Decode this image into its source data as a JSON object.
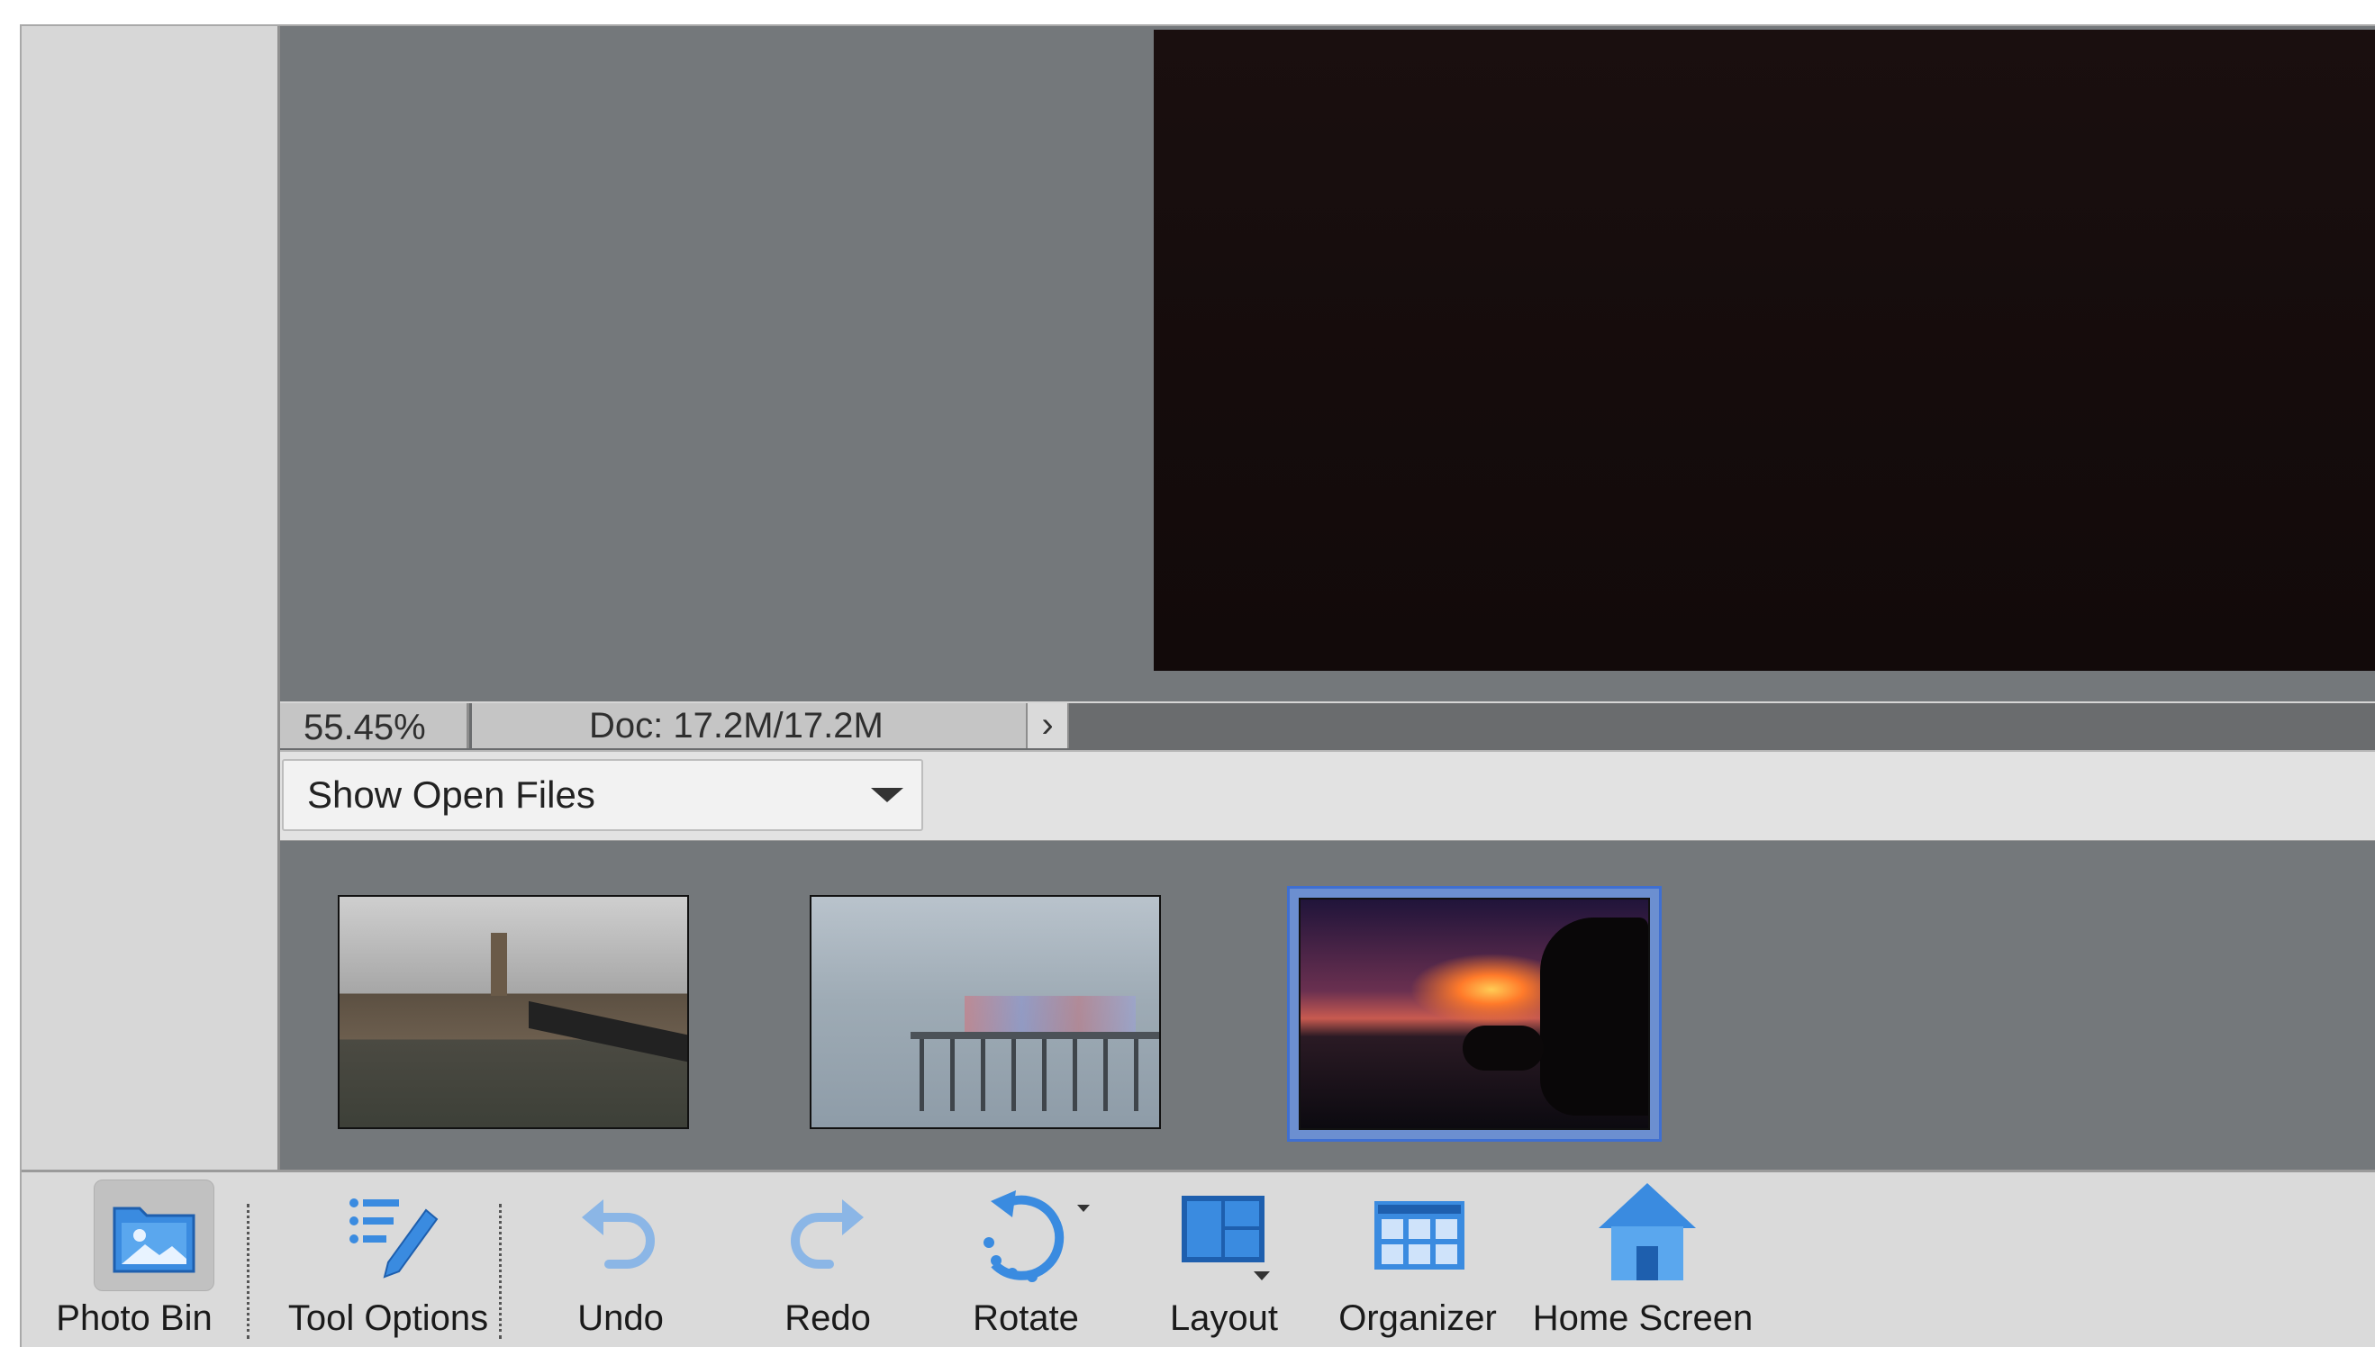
{
  "status_bar": {
    "zoom": "55.45%",
    "doc_info": "Doc: 17.2M/17.2M",
    "arrow": "›"
  },
  "photo_bin": {
    "dropdown_label": "Show Open Files",
    "thumbnails": [
      {
        "selected": false
      },
      {
        "selected": false
      },
      {
        "selected": true
      }
    ]
  },
  "taskbar": {
    "buttons": [
      {
        "label": "Photo Bin",
        "icon": "photo-bin-icon",
        "active": true
      },
      {
        "label": "Tool Options",
        "icon": "tool-options-icon"
      },
      {
        "label": "Undo",
        "icon": "undo-icon"
      },
      {
        "label": "Redo",
        "icon": "redo-icon"
      },
      {
        "label": "Rotate",
        "icon": "rotate-icon"
      },
      {
        "label": "Layout",
        "icon": "layout-icon"
      },
      {
        "label": "Organizer",
        "icon": "organizer-icon"
      },
      {
        "label": "Home Screen",
        "icon": "home-icon"
      }
    ]
  },
  "colors": {
    "canvas_bg": "#74787b",
    "accent_blue": "#3f6fd1",
    "icon_blue": "#3a8be0"
  }
}
